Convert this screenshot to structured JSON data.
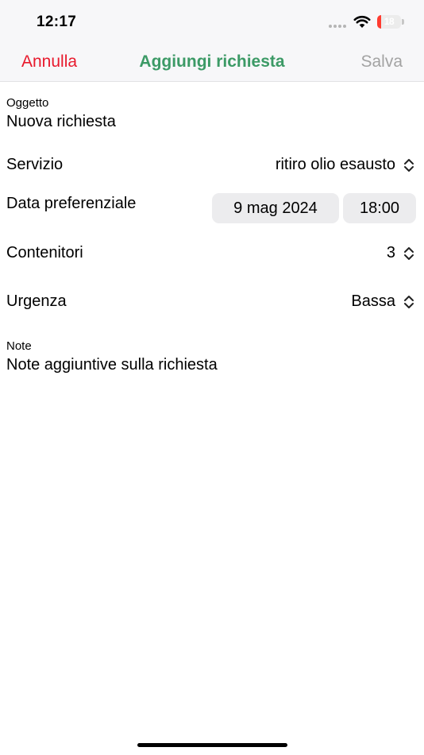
{
  "status_bar": {
    "time": "12:17",
    "battery": "18",
    "battery_fraction": 0.18,
    "battery_color": "#ff3b30"
  },
  "nav": {
    "cancel": "Annulla",
    "title": "Aggiungi richiesta",
    "save": "Salva",
    "cancel_color": "#e8192c",
    "title_color": "#3c9a66"
  },
  "form": {
    "subject": {
      "label": "Oggetto",
      "value": "Nuova richiesta"
    },
    "service": {
      "label": "Servizio",
      "value": "ritiro olio esausto"
    },
    "preferred_date": {
      "label": "Data preferenziale",
      "date": "9 mag 2024",
      "time": "18:00"
    },
    "containers": {
      "label": "Contenitori",
      "value": "3"
    },
    "urgency": {
      "label": "Urgenza",
      "value": "Bassa"
    },
    "notes": {
      "label": "Note",
      "placeholder": "Note aggiuntive sulla richiesta"
    }
  },
  "icons": {
    "wifi": "wifi-icon",
    "battery": "battery-icon",
    "picker_chevrons": "chevron-up-down-icon"
  }
}
